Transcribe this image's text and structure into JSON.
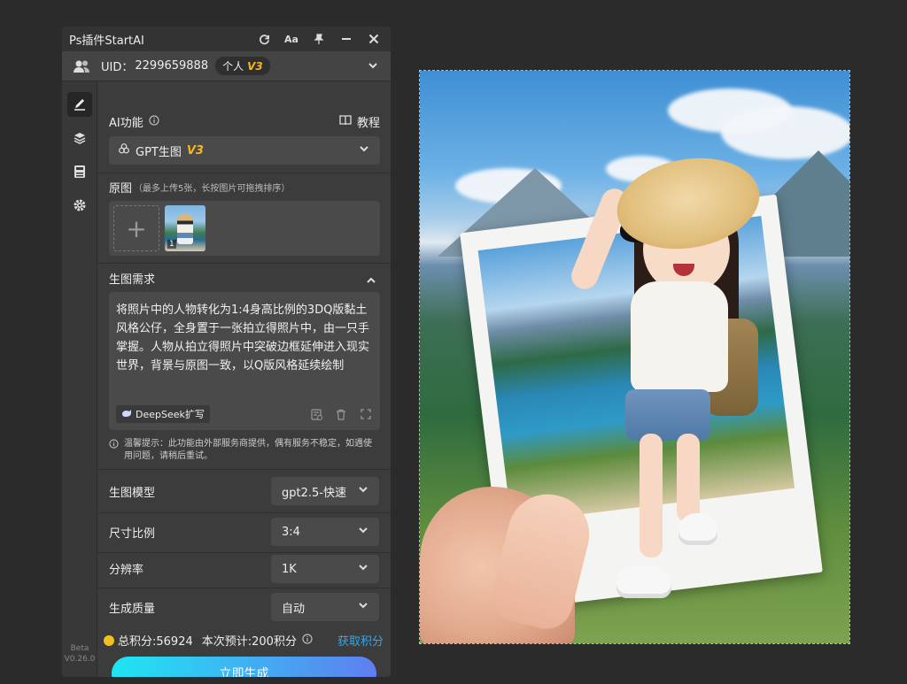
{
  "window": {
    "title": "Ps插件StartAI",
    "buttons": [
      "refresh-icon",
      "font-icon",
      "pin-icon",
      "minimize-icon",
      "close-icon"
    ]
  },
  "user": {
    "uid_label": "UID：",
    "uid_value": "2299659888",
    "plan": "个人",
    "plan_version": "V3"
  },
  "sidebar": {
    "items": [
      "pen-icon",
      "layers-icon",
      "save-icon",
      "gear-icon"
    ],
    "version_line1": "Beta",
    "version_line2": "V0.26.0"
  },
  "ai_function": {
    "label": "AI功能",
    "tutorial": "教程",
    "selected": "GPT生图",
    "selected_version": "V3"
  },
  "source_image": {
    "label": "原图",
    "hint": "（最多上传5张，长按图片可拖拽排序）",
    "thumb_index": "1"
  },
  "requirement": {
    "label": "生图需求",
    "prompt": "将照片中的人物转化为1:4身高比例的3DQ版黏土风格公仔，全身置于一张拍立得照片中，由一只手掌握。人物从拍立得照片中突破边框延伸进入现实世界，背景与原图一致，以Q版风格延续绘制",
    "deepseek": "DeepSeek扩写",
    "tip": "温馨提示：此功能由外部服务商提供，偶有服务不稳定，如遇使用问题，请稍后重试。"
  },
  "settings": {
    "model_label": "生图模型",
    "model_value": "gpt2.5-快速",
    "ratio_label": "尺寸比例",
    "ratio_value": "3:4",
    "resolution_label": "分辨率",
    "resolution_value": "1K",
    "quality_label": "生成质量",
    "quality_value": "自动"
  },
  "footer": {
    "total_points": "总积分:56924",
    "estimate": "本次预计:200积分",
    "get_points": "获取积分",
    "generate": "立即生成"
  }
}
